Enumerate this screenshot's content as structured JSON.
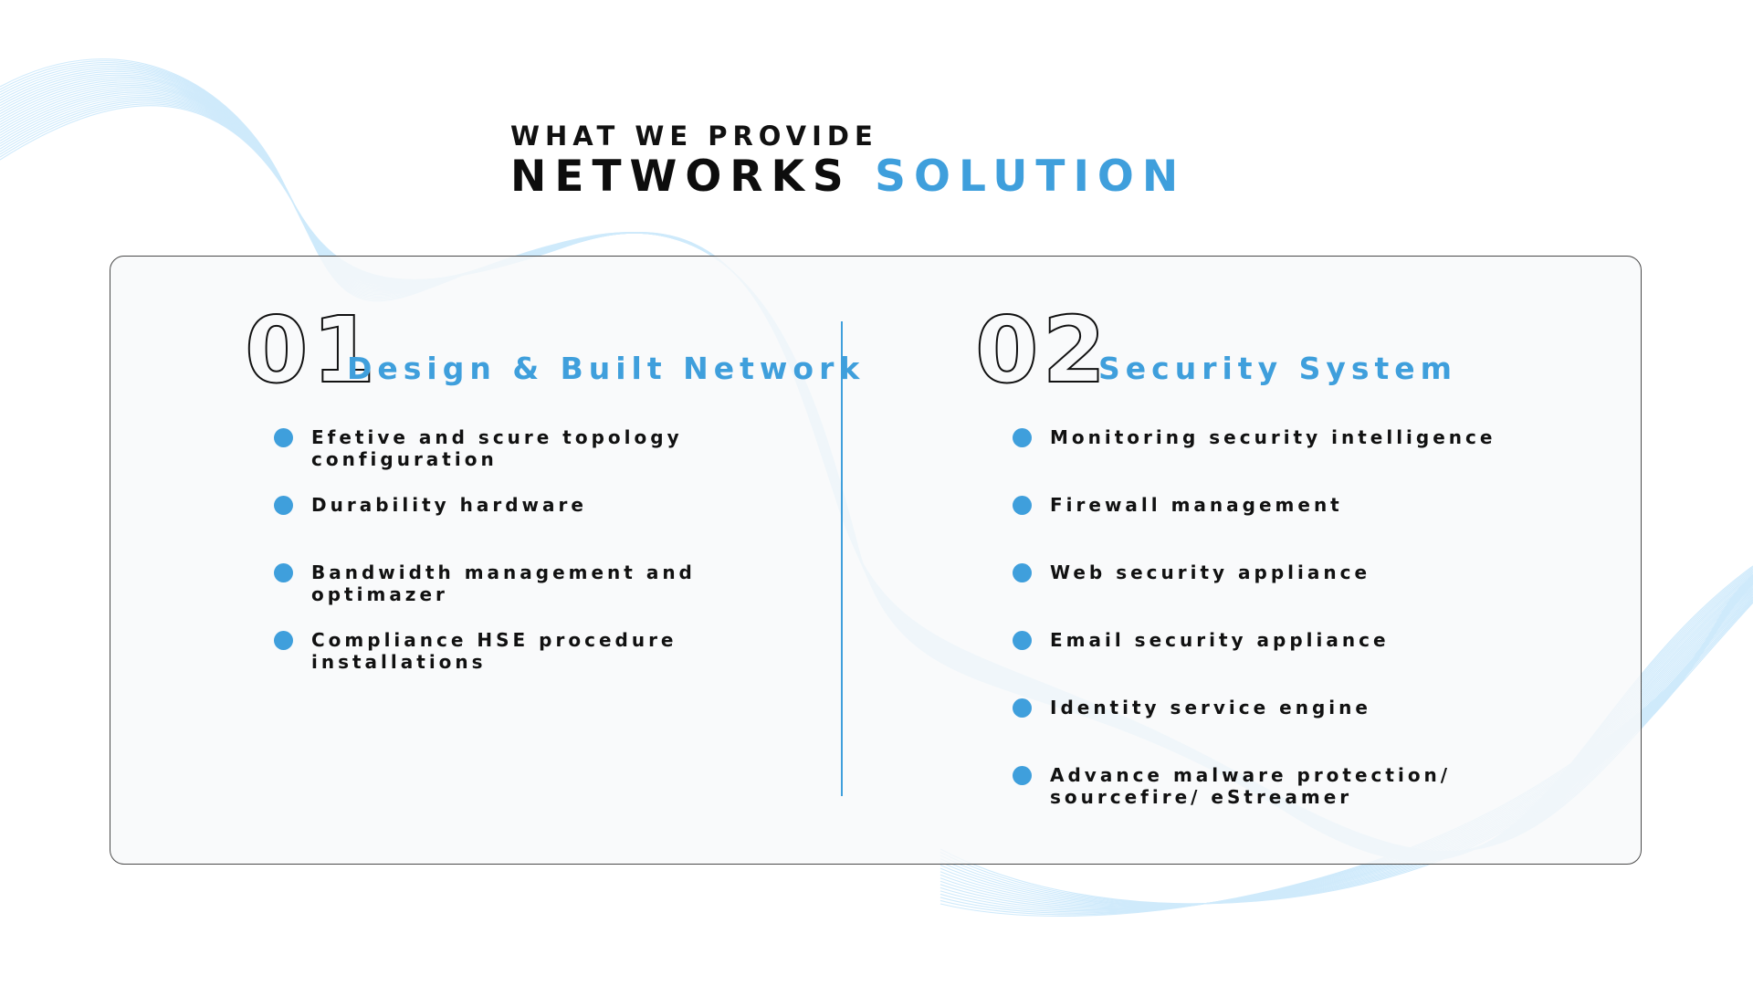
{
  "header": {
    "eyebrow": "WHAT WE PROVIDE",
    "title_main": "NETWORKS",
    "title_accent": "SOLUTION"
  },
  "colors": {
    "accent": "#3f9fdc",
    "text": "#111111",
    "card_background": "#f8f9fa",
    "wave": "#bfe3fa"
  },
  "columns": [
    {
      "number": "01",
      "heading": "Design & Built Network",
      "items": [
        [
          "Efetive and scure topology",
          "configuration"
        ],
        [
          "Durability hardware"
        ],
        [
          "Bandwidth management and",
          "optimazer"
        ],
        [
          "Compliance HSE procedure",
          "installations"
        ]
      ]
    },
    {
      "number": "02",
      "heading": "Security System",
      "items": [
        [
          "Monitoring security intelligence"
        ],
        [
          "Firewall management"
        ],
        [
          "Web security appliance"
        ],
        [
          "Email security appliance"
        ],
        [
          "Identity service engine"
        ],
        [
          "Advance malware protection/",
          "sourcefire/ eStreamer"
        ]
      ]
    }
  ]
}
